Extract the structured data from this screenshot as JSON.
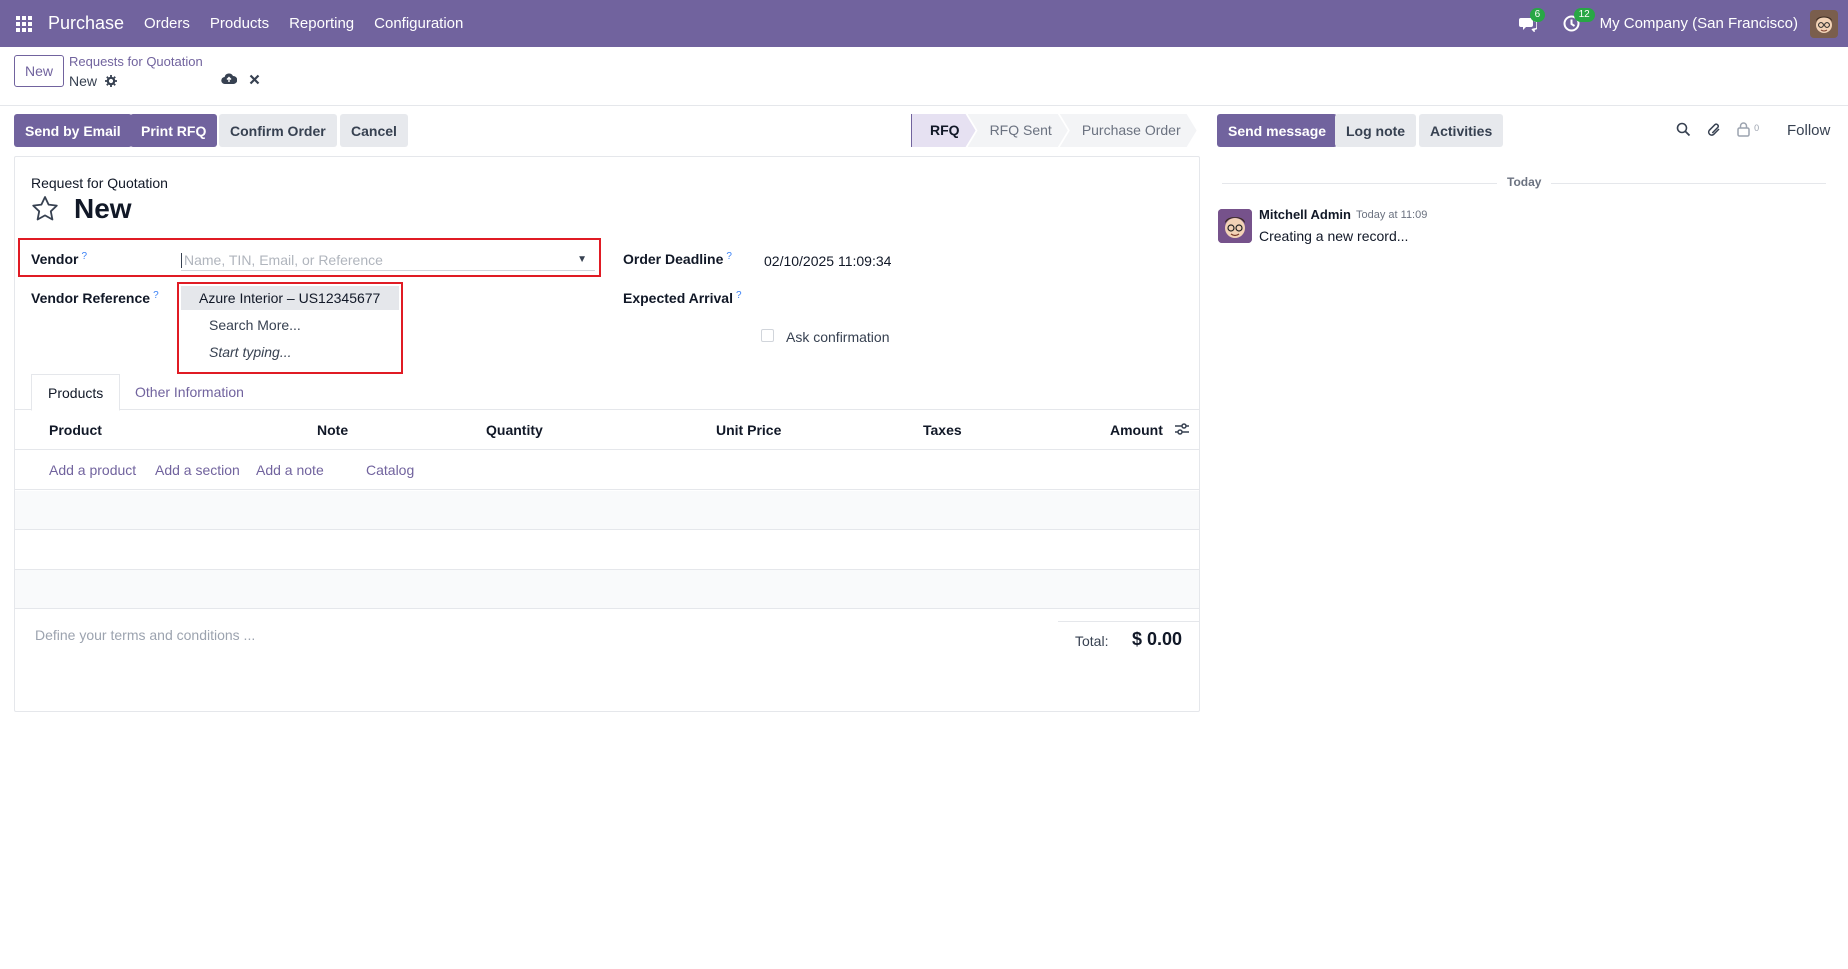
{
  "navbar": {
    "app_name": "Purchase",
    "menu": [
      "Orders",
      "Products",
      "Reporting",
      "Configuration"
    ],
    "messages_count": "6",
    "activities_count": "12",
    "company": "My Company (San Francisco)"
  },
  "control": {
    "new_label": "New",
    "breadcrumb": "Requests for Quotation",
    "record_name": "New"
  },
  "actions": {
    "send_email": "Send by Email",
    "print_rfq": "Print RFQ",
    "confirm": "Confirm Order",
    "cancel": "Cancel"
  },
  "stages": [
    "RFQ",
    "RFQ Sent",
    "Purchase Order"
  ],
  "form": {
    "doc_type": "Request for Quotation",
    "title": "New",
    "vendor_label": "Vendor",
    "vendor_placeholder": "Name, TIN, Email, or Reference",
    "vendor_ref_label": "Vendor Reference",
    "order_deadline_label": "Order Deadline",
    "order_deadline_value": "02/10/2025 11:09:34",
    "expected_arrival_label": "Expected Arrival",
    "ask_confirmation": "Ask confirmation",
    "help_mark": "?"
  },
  "dropdown": {
    "items": [
      "Azure Interior – US12345677",
      "Search More...",
      "Start typing..."
    ]
  },
  "tabs": [
    "Products",
    "Other Information"
  ],
  "table": {
    "columns": [
      "Product",
      "Note",
      "Quantity",
      "Unit Price",
      "Taxes",
      "Amount"
    ],
    "add_links": [
      "Add a product",
      "Add a section",
      "Add a note",
      "Catalog"
    ]
  },
  "footer": {
    "terms_placeholder": "Define your terms and conditions ...",
    "total_label": "Total:",
    "total_value": "$ 0.00"
  },
  "chatter": {
    "send_message": "Send message",
    "log_note": "Log note",
    "activities": "Activities",
    "followers_count": "0",
    "follow": "Follow",
    "day": "Today",
    "messages": [
      {
        "author": "Mitchell Admin",
        "date": "Today at 11:09",
        "body": "Creating a new record..."
      }
    ]
  },
  "colors": {
    "brand": "#71639e",
    "highlight_box": "#e01b24",
    "badge": "#28a745"
  }
}
